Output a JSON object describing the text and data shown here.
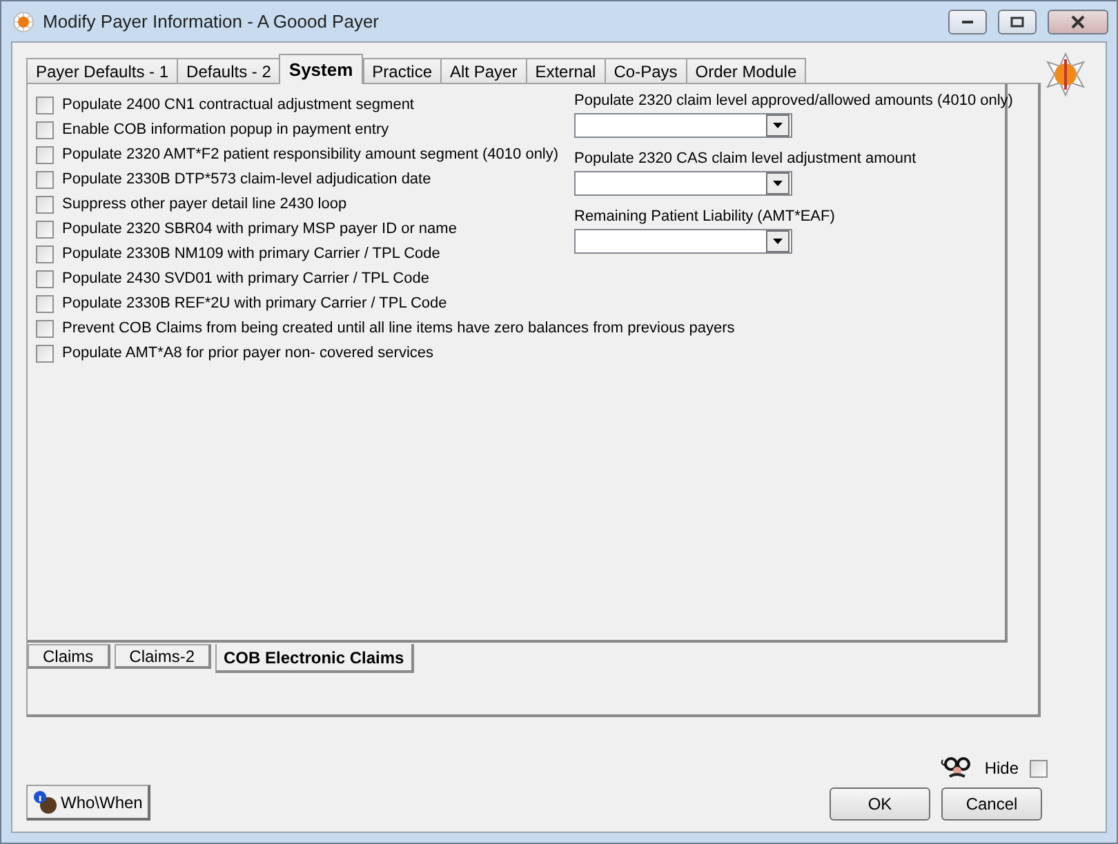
{
  "window": {
    "title": "Modify Payer Information - A Goood Payer"
  },
  "tabs": [
    {
      "label": "Payer Defaults - 1",
      "selected": false
    },
    {
      "label": "Defaults - 2",
      "selected": false
    },
    {
      "label": "System",
      "selected": true
    },
    {
      "label": "Practice",
      "selected": false
    },
    {
      "label": "Alt Payer",
      "selected": false
    },
    {
      "label": "External",
      "selected": false
    },
    {
      "label": "Co-Pays",
      "selected": false
    },
    {
      "label": "Order Module",
      "selected": false
    }
  ],
  "options": [
    {
      "label": "Populate 2400 CN1 contractual adjustment segment",
      "checked": false
    },
    {
      "label": "Enable COB information popup in payment entry",
      "checked": false
    },
    {
      "label": "Populate 2320 AMT*F2 patient responsibility amount segment (4010 only)",
      "checked": false
    },
    {
      "label": "Populate 2330B DTP*573 claim-level adjudication date",
      "checked": false
    },
    {
      "label": "Suppress other payer detail line 2430 loop",
      "checked": false
    },
    {
      "label": "Populate 2320 SBR04 with primary MSP payer ID or name",
      "checked": false
    },
    {
      "label": "Populate 2330B NM109 with primary Carrier / TPL Code",
      "checked": false
    },
    {
      "label": "Populate 2430 SVD01 with primary Carrier / TPL Code",
      "checked": false
    },
    {
      "label": "Populate 2330B REF*2U with primary Carrier / TPL Code",
      "checked": false
    },
    {
      "label": "Prevent COB Claims from being created until all line items have zero balances from previous payers",
      "checked": false
    },
    {
      "label": "Populate AMT*A8 for prior payer non- covered services",
      "checked": false
    }
  ],
  "dropdowns": [
    {
      "label": "Populate 2320 claim level approved/allowed amounts (4010 only)"
    },
    {
      "label": "Populate 2320 CAS claim level adjustment amount"
    },
    {
      "label": "Remaining Patient Liability (AMT*EAF)"
    }
  ],
  "sub_tabs": [
    {
      "label": "Claims",
      "selected": false
    },
    {
      "label": "Claims-2",
      "selected": false
    },
    {
      "label": "COB Electronic Claims",
      "selected": true
    }
  ],
  "hide": {
    "label": "Hide",
    "checked": false
  },
  "buttons": {
    "who_when": "Who\\When",
    "ok": "OK",
    "cancel": "Cancel"
  }
}
